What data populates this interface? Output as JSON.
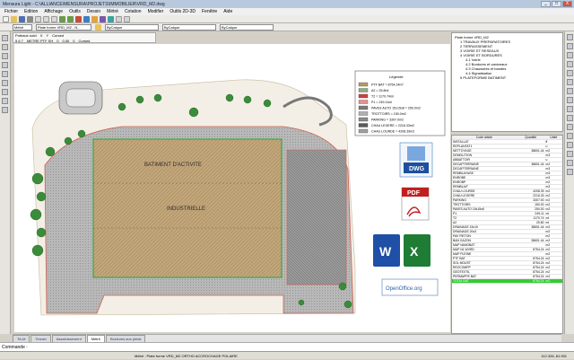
{
  "window": {
    "title": "Mensura Light - C:\\ALLIANCE\\MENSURA\\PROJETS\\IMMOBILIER\\VRD_M2.dwg",
    "controls": [
      "_",
      "□",
      "X"
    ]
  },
  "menu": [
    "Fichier",
    "Edition",
    "Affichage",
    "Outils",
    "Dessin",
    "Métré",
    "Cotation",
    "Modifier",
    "Outils 2D-3D",
    "Fenêtre",
    "Aide"
  ],
  "toolbar2": {
    "combo1": "Métré",
    "combo2": "Plate forme VRD_M2 - N...",
    "combo3": "ByCalque",
    "combo4": "ByCalque",
    "combo5": "ByCalque"
  },
  "properties": {
    "row1": [
      "Poteaux suivi",
      "X",
      "Y",
      "Cursed"
    ],
    "row2": [
      "5 6 7",
      "METRE PTF SH",
      "0",
      "0.00",
      "0",
      "Cursed"
    ]
  },
  "legend": {
    "title": "Légende",
    "entries": [
      {
        "text": "PTF BAT = 8754.24m²",
        "color": "#b89a6a"
      },
      {
        "text": "A2 = 25.8ml",
        "color": "#8fae7f"
      },
      {
        "text": "T2 = 1170.74ml",
        "color": "#d04040"
      },
      {
        "text": "P1 = 249.11ml",
        "color": "#e89090"
      },
      {
        "text": "PAVES AUTO 15x15x8 = 250.0m2",
        "color": "#7b7b7b"
      },
      {
        "text": "TROTTOIRS = 150.0m2",
        "color": "#b0b0b0"
      },
      {
        "text": "PARKING = 3307.0m2",
        "color": "#8a8a8a"
      },
      {
        "text": "CHAU LEGERE = 2216.33m2",
        "color": "#5a5a5a"
      },
      {
        "text": "CHAU LOURDE = 4208.39m2",
        "color": "#a0a0a0"
      }
    ]
  },
  "plan": {
    "building_label_1": "BATIMENT D'ACTIVITE",
    "building_label_2": "INDUSTRIELLE"
  },
  "exports": {
    "dwg": "DWG",
    "pdf": "PDF",
    "word": "W",
    "excel": "X",
    "openoffice": "OpenOffice.org"
  },
  "tree": {
    "root": "Plate forme VRD_M2",
    "items": [
      "1 TRAVAUX PREPARATOIRES",
      "2 TERRASSEMENT",
      "3 VOIRIE ET RESEAUX",
      "4 VOIRIE ET BORDURES",
      "4.1 Voirie",
      "4.2 Bordures et caniveaux",
      "4.3 Chaussées et bandes",
      "4.4 Signalisation",
      "5 PLATEFORME BATIMENT"
    ]
  },
  "quantities": {
    "headers": [
      "Code article",
      "Quantité",
      "Unité"
    ],
    "rows": [
      [
        "INSTALLAT",
        "",
        "ff"
      ],
      [
        "REPLANTAT1",
        "",
        "u"
      ],
      [
        "NETTOYAGE",
        "38601.44",
        "m2"
      ],
      [
        "DEMOLITION",
        "",
        "m3"
      ],
      [
        "ABBATTOIR",
        "",
        "u"
      ],
      [
        "DECAPTERRAINE",
        "38601.44",
        "m2"
      ],
      [
        "DECAPTERRAINE",
        "",
        "m3"
      ],
      [
        "REMBLAYAGE",
        "",
        "m3"
      ],
      [
        "ENROBE",
        "",
        "m3"
      ],
      [
        "ENROBP",
        "",
        "m2"
      ],
      [
        "REMBLAIT",
        "",
        "m3"
      ],
      [
        "CHAU LOURDE",
        "4208.39",
        "m2"
      ],
      [
        "CHAU LEGERE",
        "2216.33",
        "m2"
      ],
      [
        "PARKING",
        "3307.00",
        "m2"
      ],
      [
        "TROTTOIRS",
        "150.00",
        "m2"
      ],
      [
        "PAVES AUTO 15x15x8",
        "250.00",
        "m2"
      ],
      [
        "P1",
        "249.11",
        "ml"
      ],
      [
        "T2",
        "1170.74",
        "ml"
      ],
      [
        "A2",
        "25.80",
        "ml"
      ],
      [
        "DRAINAGE 15x10",
        "38601.44",
        "m2"
      ],
      [
        "DRAINAGE 20x3",
        "",
        "m2"
      ],
      [
        "PAV PIETON",
        "",
        "m2"
      ],
      [
        "BAN GAZON",
        "38601.44",
        "m2"
      ],
      [
        "MAP NANOBAT",
        "",
        "m2"
      ],
      [
        "MAP N1 WVRD",
        "8754.24",
        "m2"
      ],
      [
        "MAP PLEINE",
        "",
        "m2"
      ],
      [
        "PTF BAT",
        "8754.24",
        "m2"
      ],
      [
        "SOL MOUST",
        "8754.24",
        "m2"
      ],
      [
        "REOCOMPP",
        "8754.24",
        "m2"
      ],
      [
        "GEOTEXTIL",
        "8754.24",
        "m2"
      ],
      [
        "PERMAPPE BAT",
        "8754.24",
        "m2"
      ],
      [
        "TOTAL BAT",
        "8754.24",
        "m2"
      ]
    ],
    "highlight_row": 31
  },
  "tabs": [
    "TA-M",
    "Terrain",
    "Assainissement",
    "Métré",
    "Bordures aux pieds"
  ],
  "active_tab": 3,
  "cmdline": "Commande :",
  "status": "Métré : Plate forme VRD_M2   ORTHO   ACCROCHAGE   POLAIRE",
  "coords": "112.326, 81.931"
}
